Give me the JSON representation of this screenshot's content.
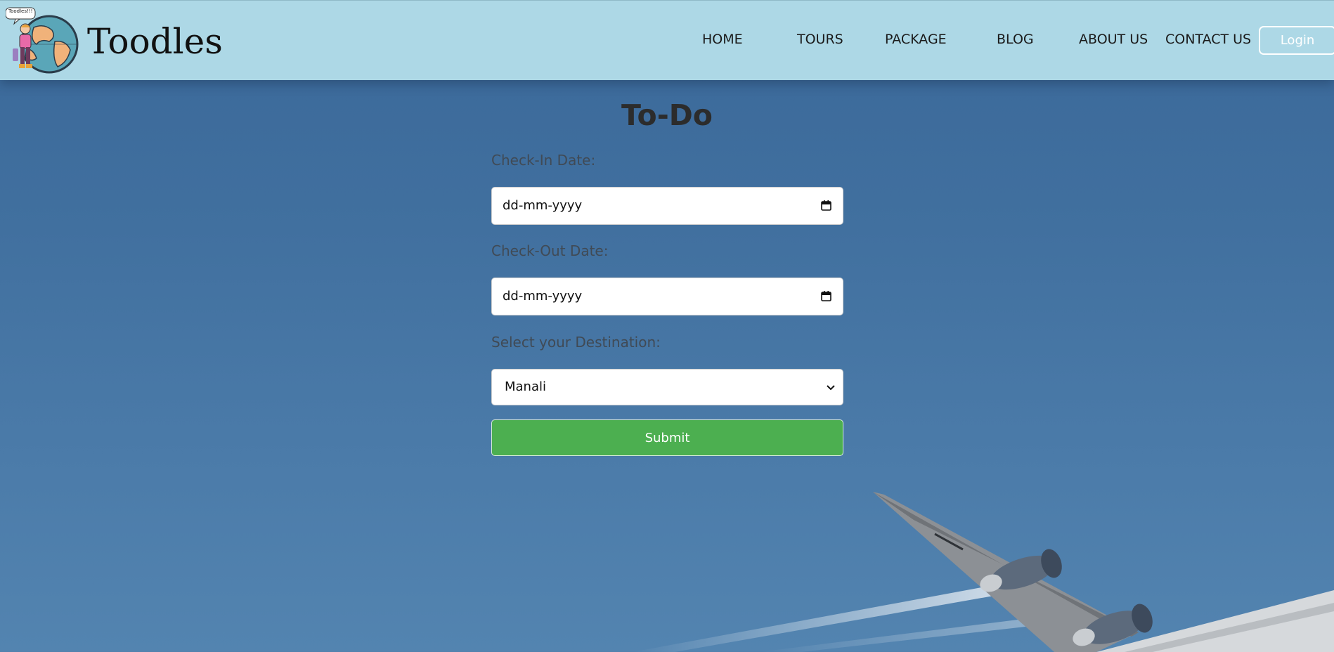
{
  "header": {
    "brand": "Toodles",
    "logo_bubble_text": "Toodles!!!",
    "nav": [
      {
        "label": "HOME"
      },
      {
        "label": "TOURS"
      },
      {
        "label": "PACKAGE"
      },
      {
        "label": "BLOG"
      },
      {
        "label": "ABOUT US"
      },
      {
        "label": "CONTACT US"
      }
    ],
    "login_label": "Login"
  },
  "form": {
    "title": "To-Do",
    "checkin_label": "Check-In Date:",
    "checkin_value": "dd-mm-yyyy",
    "checkout_label": "Check-Out Date:",
    "checkout_value": "dd-mm-yyyy",
    "destination_label": "Select your Destination:",
    "destination_value": "Manali",
    "submit_label": "Submit"
  },
  "colors": {
    "header_bg": "#add8e6",
    "submit_bg": "#4caf50",
    "sky": "#41709f"
  },
  "icons": {
    "calendar": "calendar-icon",
    "select": "chevron-down-icon",
    "logo": "globe-traveler-logo"
  }
}
